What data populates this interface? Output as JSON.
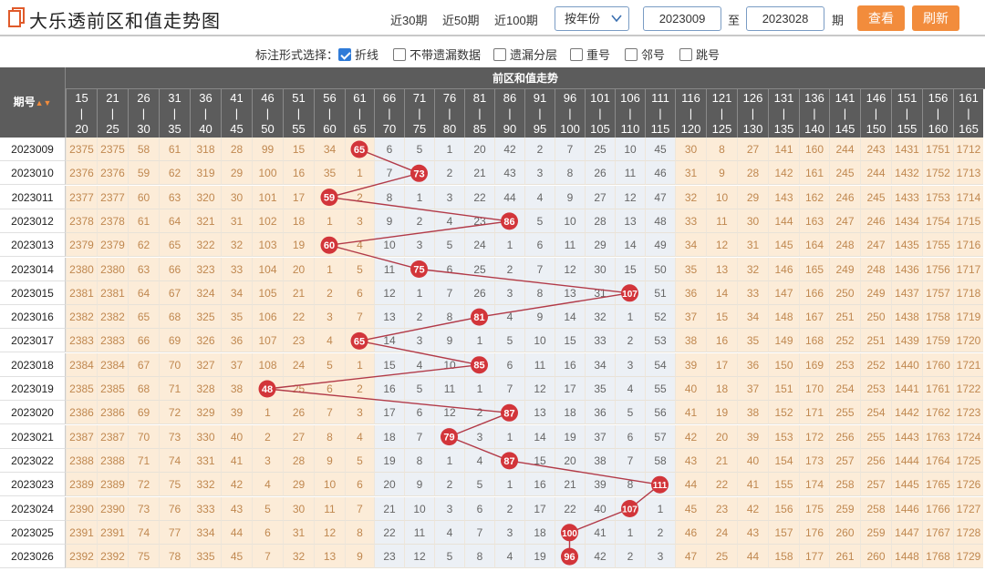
{
  "header": {
    "title": "大乐透前区和值走势图",
    "periods": [
      "近30期",
      "近50期",
      "近100期"
    ],
    "select_value": "按年份",
    "start_issue": "2023009",
    "range_sep": "至",
    "end_issue": "2023028",
    "period_unit": "期",
    "query_label": "查看",
    "refresh_label": "刷新"
  },
  "options": {
    "label": "标注形式选择：",
    "items": [
      {
        "label": "折线",
        "checked": true
      },
      {
        "label": "不带遗漏数据",
        "checked": false
      },
      {
        "label": "遗漏分层",
        "checked": false
      },
      {
        "label": "重号",
        "checked": false
      },
      {
        "label": "邻号",
        "checked": false
      },
      {
        "label": "跳号",
        "checked": false
      }
    ]
  },
  "table": {
    "issue_header": "期号",
    "group_header": "前区和值走势",
    "columns": [
      [
        "15",
        "20"
      ],
      [
        "21",
        "25"
      ],
      [
        "26",
        "30"
      ],
      [
        "31",
        "35"
      ],
      [
        "36",
        "40"
      ],
      [
        "41",
        "45"
      ],
      [
        "46",
        "50"
      ],
      [
        "51",
        "55"
      ],
      [
        "56",
        "60"
      ],
      [
        "61",
        "65"
      ],
      [
        "66",
        "70"
      ],
      [
        "71",
        "75"
      ],
      [
        "76",
        "80"
      ],
      [
        "81",
        "85"
      ],
      [
        "86",
        "90"
      ],
      [
        "91",
        "95"
      ],
      [
        "96",
        "100"
      ],
      [
        "101",
        "105"
      ],
      [
        "106",
        "110"
      ],
      [
        "111",
        "115"
      ],
      [
        "116",
        "120"
      ],
      [
        "121",
        "125"
      ],
      [
        "126",
        "130"
      ],
      [
        "131",
        "135"
      ],
      [
        "136",
        "140"
      ],
      [
        "141",
        "145"
      ],
      [
        "146",
        "150"
      ],
      [
        "151",
        "155"
      ],
      [
        "156",
        "160"
      ],
      [
        "161",
        "165"
      ]
    ],
    "hit_color": "#d2353a",
    "line_color": "#b23a48",
    "rows": [
      {
        "issue": "2023009",
        "hit": 9,
        "value": "65",
        "cells": [
          "2375",
          "2375",
          "58",
          "61",
          "318",
          "28",
          "99",
          "15",
          "34",
          "65",
          "6",
          "5",
          "1",
          "20",
          "42",
          "2",
          "7",
          "25",
          "10",
          "45",
          "30",
          "8",
          "27",
          "141",
          "160",
          "244",
          "243",
          "1431",
          "1751",
          "1712"
        ]
      },
      {
        "issue": "2023010",
        "hit": 11,
        "value": "73",
        "cells": [
          "2376",
          "2376",
          "59",
          "62",
          "319",
          "29",
          "100",
          "16",
          "35",
          "1",
          "7",
          "73",
          "2",
          "21",
          "43",
          "3",
          "8",
          "26",
          "11",
          "46",
          "31",
          "9",
          "28",
          "142",
          "161",
          "245",
          "244",
          "1432",
          "1752",
          "1713"
        ]
      },
      {
        "issue": "2023011",
        "hit": 8,
        "value": "59",
        "cells": [
          "2377",
          "2377",
          "60",
          "63",
          "320",
          "30",
          "101",
          "17",
          "59",
          "2",
          "8",
          "1",
          "3",
          "22",
          "44",
          "4",
          "9",
          "27",
          "12",
          "47",
          "32",
          "10",
          "29",
          "143",
          "162",
          "246",
          "245",
          "1433",
          "1753",
          "1714"
        ]
      },
      {
        "issue": "2023012",
        "hit": 14,
        "value": "86",
        "cells": [
          "2378",
          "2378",
          "61",
          "64",
          "321",
          "31",
          "102",
          "18",
          "1",
          "3",
          "9",
          "2",
          "4",
          "23",
          "86",
          "5",
          "10",
          "28",
          "13",
          "48",
          "33",
          "11",
          "30",
          "144",
          "163",
          "247",
          "246",
          "1434",
          "1754",
          "1715"
        ]
      },
      {
        "issue": "2023013",
        "hit": 8,
        "value": "60",
        "cells": [
          "2379",
          "2379",
          "62",
          "65",
          "322",
          "32",
          "103",
          "19",
          "60",
          "4",
          "10",
          "3",
          "5",
          "24",
          "1",
          "6",
          "11",
          "29",
          "14",
          "49",
          "34",
          "12",
          "31",
          "145",
          "164",
          "248",
          "247",
          "1435",
          "1755",
          "1716"
        ]
      },
      {
        "issue": "2023014",
        "hit": 11,
        "value": "75",
        "cells": [
          "2380",
          "2380",
          "63",
          "66",
          "323",
          "33",
          "104",
          "20",
          "1",
          "5",
          "11",
          "75",
          "6",
          "25",
          "2",
          "7",
          "12",
          "30",
          "15",
          "50",
          "35",
          "13",
          "32",
          "146",
          "165",
          "249",
          "248",
          "1436",
          "1756",
          "1717"
        ]
      },
      {
        "issue": "2023015",
        "hit": 18,
        "value": "107",
        "cells": [
          "2381",
          "2381",
          "64",
          "67",
          "324",
          "34",
          "105",
          "21",
          "2",
          "6",
          "12",
          "1",
          "7",
          "26",
          "3",
          "8",
          "13",
          "31",
          "107",
          "51",
          "36",
          "14",
          "33",
          "147",
          "166",
          "250",
          "249",
          "1437",
          "1757",
          "1718"
        ]
      },
      {
        "issue": "2023016",
        "hit": 13,
        "value": "81",
        "cells": [
          "2382",
          "2382",
          "65",
          "68",
          "325",
          "35",
          "106",
          "22",
          "3",
          "7",
          "13",
          "2",
          "8",
          "81",
          "4",
          "9",
          "14",
          "32",
          "1",
          "52",
          "37",
          "15",
          "34",
          "148",
          "167",
          "251",
          "250",
          "1438",
          "1758",
          "1719"
        ]
      },
      {
        "issue": "2023017",
        "hit": 9,
        "value": "65",
        "cells": [
          "2383",
          "2383",
          "66",
          "69",
          "326",
          "36",
          "107",
          "23",
          "4",
          "65",
          "14",
          "3",
          "9",
          "1",
          "5",
          "10",
          "15",
          "33",
          "2",
          "53",
          "38",
          "16",
          "35",
          "149",
          "168",
          "252",
          "251",
          "1439",
          "1759",
          "1720"
        ]
      },
      {
        "issue": "2023018",
        "hit": 13,
        "value": "85",
        "cells": [
          "2384",
          "2384",
          "67",
          "70",
          "327",
          "37",
          "108",
          "24",
          "5",
          "1",
          "15",
          "4",
          "10",
          "85",
          "6",
          "11",
          "16",
          "34",
          "3",
          "54",
          "39",
          "17",
          "36",
          "150",
          "169",
          "253",
          "252",
          "1440",
          "1760",
          "1721"
        ]
      },
      {
        "issue": "2023019",
        "hit": 6,
        "value": "48",
        "cells": [
          "2385",
          "2385",
          "68",
          "71",
          "328",
          "38",
          "48",
          "25",
          "6",
          "2",
          "16",
          "5",
          "11",
          "1",
          "7",
          "12",
          "17",
          "35",
          "4",
          "55",
          "40",
          "18",
          "37",
          "151",
          "170",
          "254",
          "253",
          "1441",
          "1761",
          "1722"
        ]
      },
      {
        "issue": "2023020",
        "hit": 14,
        "value": "87",
        "cells": [
          "2386",
          "2386",
          "69",
          "72",
          "329",
          "39",
          "1",
          "26",
          "7",
          "3",
          "17",
          "6",
          "12",
          "2",
          "87",
          "13",
          "18",
          "36",
          "5",
          "56",
          "41",
          "19",
          "38",
          "152",
          "171",
          "255",
          "254",
          "1442",
          "1762",
          "1723"
        ]
      },
      {
        "issue": "2023021",
        "hit": 12,
        "value": "79",
        "cells": [
          "2387",
          "2387",
          "70",
          "73",
          "330",
          "40",
          "2",
          "27",
          "8",
          "4",
          "18",
          "7",
          "79",
          "3",
          "1",
          "14",
          "19",
          "37",
          "6",
          "57",
          "42",
          "20",
          "39",
          "153",
          "172",
          "256",
          "255",
          "1443",
          "1763",
          "1724"
        ]
      },
      {
        "issue": "2023022",
        "hit": 14,
        "value": "87",
        "cells": [
          "2388",
          "2388",
          "71",
          "74",
          "331",
          "41",
          "3",
          "28",
          "9",
          "5",
          "19",
          "8",
          "1",
          "4",
          "87",
          "15",
          "20",
          "38",
          "7",
          "58",
          "43",
          "21",
          "40",
          "154",
          "173",
          "257",
          "256",
          "1444",
          "1764",
          "1725"
        ]
      },
      {
        "issue": "2023023",
        "hit": 19,
        "value": "111",
        "cells": [
          "2389",
          "2389",
          "72",
          "75",
          "332",
          "42",
          "4",
          "29",
          "10",
          "6",
          "20",
          "9",
          "2",
          "5",
          "1",
          "16",
          "21",
          "39",
          "8",
          "111",
          "44",
          "22",
          "41",
          "155",
          "174",
          "258",
          "257",
          "1445",
          "1765",
          "1726"
        ]
      },
      {
        "issue": "2023024",
        "hit": 18,
        "value": "107",
        "cells": [
          "2390",
          "2390",
          "73",
          "76",
          "333",
          "43",
          "5",
          "30",
          "11",
          "7",
          "21",
          "10",
          "3",
          "6",
          "2",
          "17",
          "22",
          "40",
          "107",
          "1",
          "45",
          "23",
          "42",
          "156",
          "175",
          "259",
          "258",
          "1446",
          "1766",
          "1727"
        ]
      },
      {
        "issue": "2023025",
        "hit": 16,
        "value": "100",
        "cells": [
          "2391",
          "2391",
          "74",
          "77",
          "334",
          "44",
          "6",
          "31",
          "12",
          "8",
          "22",
          "11",
          "4",
          "7",
          "3",
          "18",
          "100",
          "41",
          "1",
          "2",
          "46",
          "24",
          "43",
          "157",
          "176",
          "260",
          "259",
          "1447",
          "1767",
          "1728"
        ]
      },
      {
        "issue": "2023026",
        "hit": 16,
        "value": "96",
        "cells": [
          "2392",
          "2392",
          "75",
          "78",
          "335",
          "45",
          "7",
          "32",
          "13",
          "9",
          "23",
          "12",
          "5",
          "8",
          "4",
          "19",
          "96",
          "42",
          "2",
          "3",
          "47",
          "25",
          "44",
          "158",
          "177",
          "261",
          "260",
          "1448",
          "1768",
          "1729"
        ]
      }
    ]
  }
}
